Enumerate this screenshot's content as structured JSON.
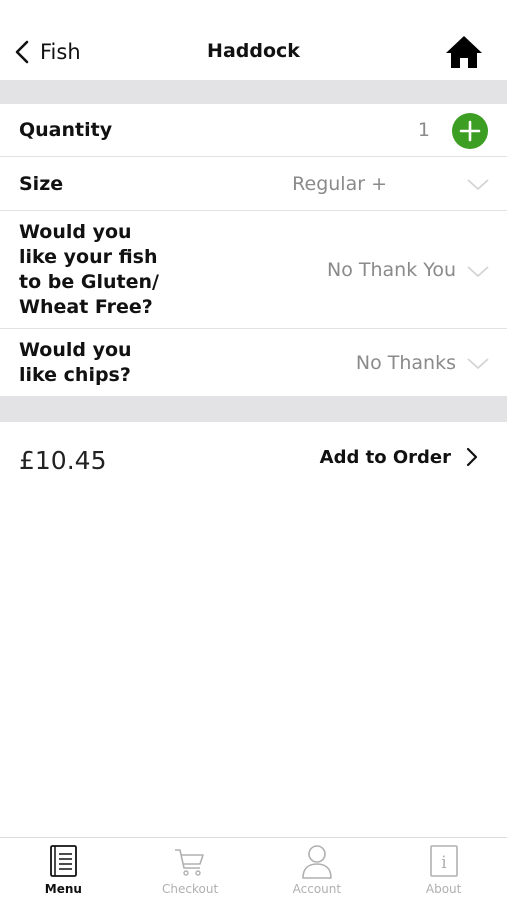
{
  "nav": {
    "back_label": "Fish",
    "title": "Haddock"
  },
  "options": {
    "quantity": {
      "label": "Quantity",
      "value": "1"
    },
    "size": {
      "label": "Size",
      "value": "Regular +"
    },
    "gluten": {
      "label_lines": [
        "Would you",
        "like your fish",
        "to be Gluten/",
        "Wheat Free?"
      ],
      "value": "No Thank You"
    },
    "chips": {
      "label_lines": [
        "Would you",
        "like chips?"
      ],
      "value": "No Thanks"
    }
  },
  "order": {
    "price": "£10.45",
    "add_label": "Add to Order"
  },
  "tabs": [
    {
      "label": "Menu",
      "icon": "menu-book-icon",
      "active": true
    },
    {
      "label": "Checkout",
      "icon": "cart-icon",
      "active": false
    },
    {
      "label": "Account",
      "icon": "person-icon",
      "active": false
    },
    {
      "label": "About",
      "icon": "info-icon",
      "active": false
    }
  ],
  "colors": {
    "accent_green": "#3d9e24",
    "separator": "#e3e3e5",
    "inactive_tab": "#b0b0b0"
  }
}
